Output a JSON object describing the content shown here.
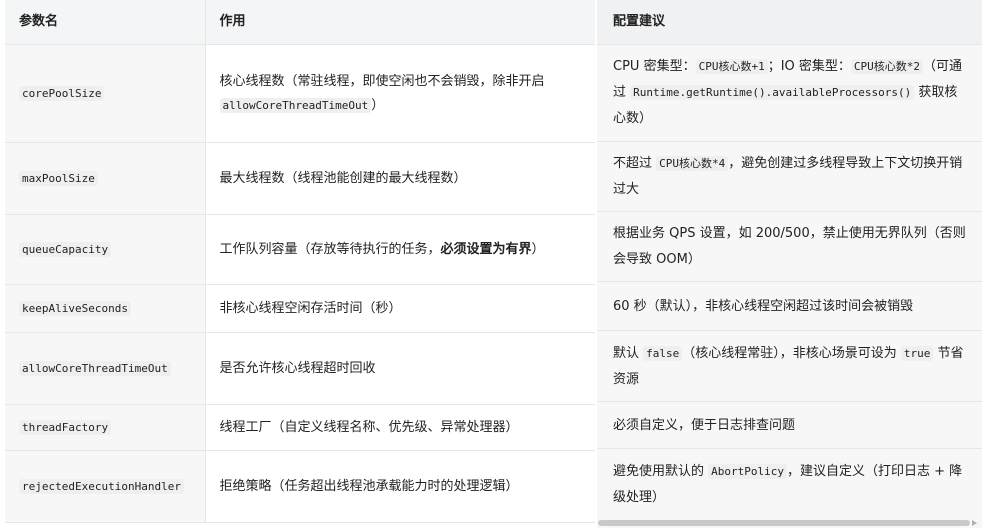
{
  "headers": {
    "col1": "参数名",
    "col2": "作用",
    "col3": "配置建议"
  },
  "rows": [
    {
      "name": "corePoolSize",
      "effect_a": "核心线程数（常驻线程，即使空闲也不会销毁，除非开启 ",
      "effect_code": "allowCoreThreadTimeOut",
      "effect_b": "）",
      "advice": [
        {
          "t": "text",
          "v": "CPU 密集型："
        },
        {
          "t": "code",
          "v": "CPU核心数+1"
        },
        {
          "t": "text",
          "v": "；IO 密集型："
        },
        {
          "t": "code",
          "v": "CPU核心数*2"
        },
        {
          "t": "text",
          "v": "（可通过 "
        },
        {
          "t": "code",
          "v": "Runtime.getRuntime().availableProcessors()"
        },
        {
          "t": "text",
          "v": " 获取核心数）"
        }
      ]
    },
    {
      "name": "maxPoolSize",
      "effect_a": "最大线程数（线程池能创建的最大线程数）",
      "advice": [
        {
          "t": "text",
          "v": "不超过 "
        },
        {
          "t": "code",
          "v": "CPU核心数*4"
        },
        {
          "t": "text",
          "v": "，避免创建过多线程导致上下文切换开销过大"
        }
      ]
    },
    {
      "name": "queueCapacity",
      "effect_a": "工作队列容量（存放等待执行的任务，",
      "effect_bold": "必须设置为有界",
      "effect_b": "）",
      "advice": [
        {
          "t": "text",
          "v": "根据业务 QPS 设置，如 200/500，禁止使用无界队列（否则会导致 OOM）"
        }
      ]
    },
    {
      "name": "keepAliveSeconds",
      "effect_a": "非核心线程空闲存活时间（秒）",
      "advice": [
        {
          "t": "text",
          "v": "60 秒（默认），非核心线程空闲超过该时间会被销毁"
        }
      ]
    },
    {
      "name": "allowCoreThreadTimeOut",
      "effect_a": "是否允许核心线程超时回收",
      "advice": [
        {
          "t": "text",
          "v": "默认 "
        },
        {
          "t": "code",
          "v": "false"
        },
        {
          "t": "text",
          "v": "（核心线程常驻），非核心场景可设为 "
        },
        {
          "t": "code",
          "v": "true"
        },
        {
          "t": "text",
          "v": " 节省资源"
        }
      ]
    },
    {
      "name": "threadFactory",
      "effect_a": "线程工厂（自定义线程名称、优先级、异常处理器）",
      "advice": [
        {
          "t": "text",
          "v": "必须自定义，便于日志排查问题"
        }
      ]
    },
    {
      "name": "rejectedExecutionHandler",
      "effect_a": "拒绝策略（任务超出线程池承载能力时的处理逻辑）",
      "advice": [
        {
          "t": "text",
          "v": "避免使用默认的 "
        },
        {
          "t": "code",
          "v": "AbortPolicy"
        },
        {
          "t": "text",
          "v": "，建议自定义（打印日志 + 降级处理）"
        }
      ]
    }
  ]
}
